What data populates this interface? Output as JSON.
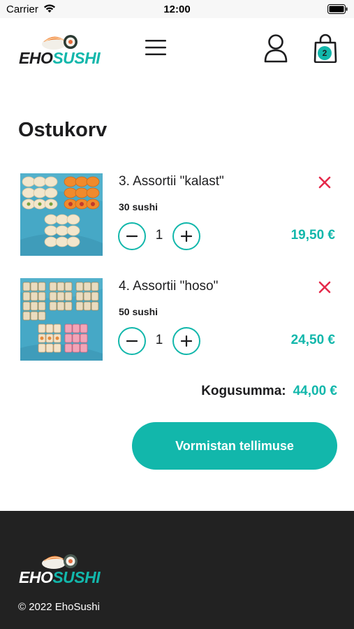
{
  "status_bar": {
    "carrier": "Carrier",
    "time": "12:00"
  },
  "header": {
    "logo": {
      "part1": "EHO",
      "part2": "SUSHI"
    },
    "cart_count": "2"
  },
  "page_title": "Ostukorv",
  "cart": {
    "items": [
      {
        "name": "3. Assortii \"kalast\"",
        "desc": "30 sushi",
        "quantity": "1",
        "price": "19,50 €"
      },
      {
        "name": "4. Assortii \"hoso\"",
        "desc": "50 sushi",
        "quantity": "1",
        "price": "24,50 €"
      }
    ],
    "total_label": "Kogusumma:",
    "total_value": "44,00 €",
    "checkout_label": "Vormistan tellimuse"
  },
  "footer": {
    "logo": {
      "part1": "EHO",
      "part2": "SUSHI"
    },
    "copyright": "© 2022 EhoSushi"
  },
  "colors": {
    "accent": "#12b7ab",
    "remove": "#e5294a",
    "footer_bg": "#222222"
  },
  "icons": [
    "wifi-icon",
    "battery-icon",
    "menu-icon",
    "user-icon",
    "cart-icon",
    "remove-icon",
    "minus-icon",
    "plus-icon"
  ]
}
